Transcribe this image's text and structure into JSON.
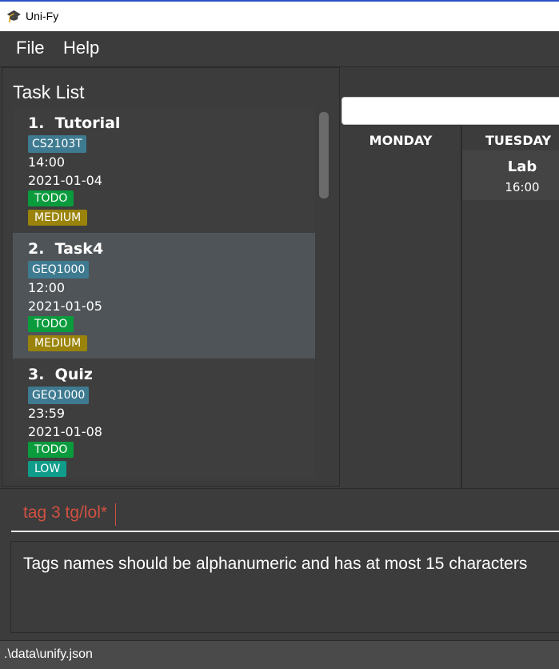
{
  "window": {
    "title": "Uni-Fy",
    "icon": "graduation-cap-icon"
  },
  "menu": {
    "items": [
      "File",
      "Help"
    ]
  },
  "task_list": {
    "title": "Task List",
    "tasks": [
      {
        "index_name": "1.  Tutorial",
        "module": "CS2103T",
        "time": "14:00",
        "date": "2021-01-04",
        "state": "TODO",
        "priority": "MEDIUM"
      },
      {
        "index_name": "2.  Task4",
        "module": "GEQ1000",
        "time": "12:00",
        "date": "2021-01-05",
        "state": "TODO",
        "priority": "MEDIUM"
      },
      {
        "index_name": "3.  Quiz",
        "module": "GEQ1000",
        "time": "23:59",
        "date": "2021-01-08",
        "state": "TODO",
        "priority": "LOW"
      }
    ]
  },
  "calendar": {
    "search_value": "",
    "days": [
      {
        "name": "MONDAY",
        "events": []
      },
      {
        "name": "TUESDAY",
        "events": [
          {
            "name": "Lab",
            "time": "16:00"
          }
        ]
      }
    ]
  },
  "command": {
    "value": "tag 3 tg/lol*"
  },
  "result": {
    "message": "Tags names should be alphanumeric and has at most 15 characters"
  },
  "status": {
    "path": ".\\data\\unify.json"
  },
  "colors": {
    "error_text": "#d05040",
    "todo": "#0a9b3d",
    "medium": "#9a830a",
    "low": "#0f9c8a",
    "module": "#3e7b91"
  }
}
